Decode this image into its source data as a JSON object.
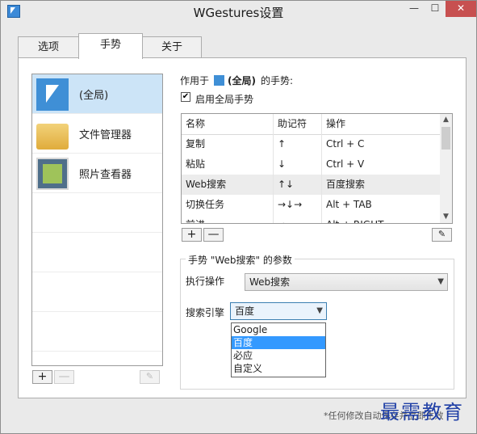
{
  "window": {
    "title": "WGestures设置"
  },
  "titlebar": {
    "minimize": "—",
    "maximize": "☐",
    "close": "✕"
  },
  "tabs": [
    {
      "label": "选项"
    },
    {
      "label": "手势"
    },
    {
      "label": "关于"
    }
  ],
  "apps": [
    {
      "label": "(全局)",
      "icon": "gesture-cursor-icon"
    },
    {
      "label": "文件管理器",
      "icon": "folder-icon"
    },
    {
      "label": "照片查看器",
      "icon": "photo-viewer-icon"
    }
  ],
  "app_buttons": {
    "add": "+",
    "remove": "—",
    "edit": "✎"
  },
  "scope": {
    "prefix": "作用于",
    "target": "(全局)",
    "suffix": "的手势:"
  },
  "enable_global": {
    "checked": "✔",
    "label": "启用全局手势"
  },
  "gesture_table": {
    "columns": [
      "名称",
      "助记符",
      "操作"
    ],
    "rows": [
      {
        "name": "复制",
        "mnemonic": "↑",
        "action": "Ctrl + C"
      },
      {
        "name": "粘贴",
        "mnemonic": "↓",
        "action": "Ctrl + V"
      },
      {
        "name": "Web搜索",
        "mnemonic": "↑↓",
        "action": "百度搜索"
      },
      {
        "name": "切换任务",
        "mnemonic": "→↓→",
        "action": "Alt + TAB"
      },
      {
        "name": "前进",
        "mnemonic": "→",
        "action": "Alt + RIGHT"
      }
    ],
    "scroll_up": "▲",
    "scroll_down": "▼"
  },
  "table_buttons": {
    "add": "+",
    "remove": "—",
    "edit": "✎"
  },
  "params": {
    "title": "手势 \"Web搜索\" 的参数",
    "action_label": "执行操作",
    "action_value": "Web搜索",
    "engine_label": "搜索引擎",
    "engine_value": "百度",
    "engine_options": [
      "Google",
      "百度",
      "必应",
      "自定义"
    ]
  },
  "footer": {
    "note": "*任何修改自动保存并立即生效"
  },
  "watermark": {
    "text": "最需教育"
  }
}
